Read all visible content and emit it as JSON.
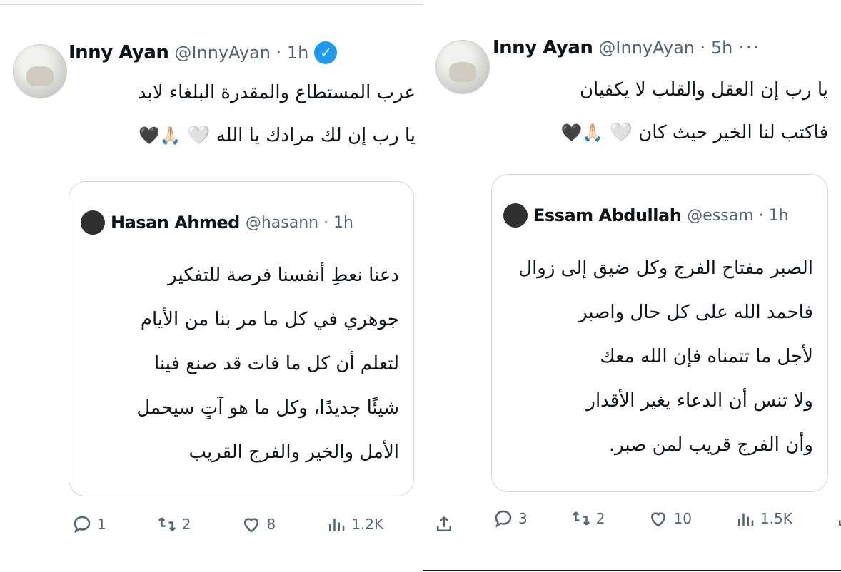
{
  "left_tweet": {
    "author_name": "Inny Ayan",
    "handle": "@InnyAyan · 1h",
    "verified_mark": "✓",
    "more": "···",
    "text_line1": "عرب المستطاع والمقدرة البلغاء لابد",
    "text_line2": "يا رب إن لك مرادك يا الله 🤍",
    "emoji": "🙏🏻🖤",
    "quote": {
      "author_name": "Hasan Ahmed",
      "handle": "@hasann · 1h",
      "lines": [
        "دعنا نعطِ أنفسنا فرصة للتفكير",
        "جوهري في كل ما مر بنا من الأيام",
        "لتعلم أن كل ما فات قد صنع فينا",
        "شيئًا جديدًا، وكل ما هو آتٍ سيحمل",
        "الأمل والخير والفرج القريب"
      ]
    },
    "actions": {
      "reply_count": "1",
      "repost_count": "2",
      "like_count": "8",
      "views_count": "1.2K"
    }
  },
  "right_tweet": {
    "author_name": "Inny Ayan",
    "handle": "@InnyAyan · 5h",
    "more": "···",
    "text_line1": "يا رب إن العقل والقلب لا يكفيان",
    "text_line2": "فاكتب لنا الخير حيث كان 🤍",
    "emoji": "🙏🏻🖤",
    "quote": {
      "author_name": "Essam Abdullah",
      "handle": "@essam · 1h",
      "lines": [
        "الصبر مفتاح الفرج وكل ضيق إلى زوال",
        "فاحمد الله على كل حال واصبر",
        "لأجل ما تتمناه فإن الله معك",
        "ولا تنس أن الدعاء يغير الأقدار",
        "وأن الفرج قريب لمن صبر."
      ]
    },
    "actions": {
      "reply_count": "3",
      "repost_count": "2",
      "like_count": "10",
      "views_count": "1.5K"
    }
  },
  "colors": {
    "verified": "#1d9bf0",
    "muted": "#536471",
    "border": "#cfd9de"
  }
}
